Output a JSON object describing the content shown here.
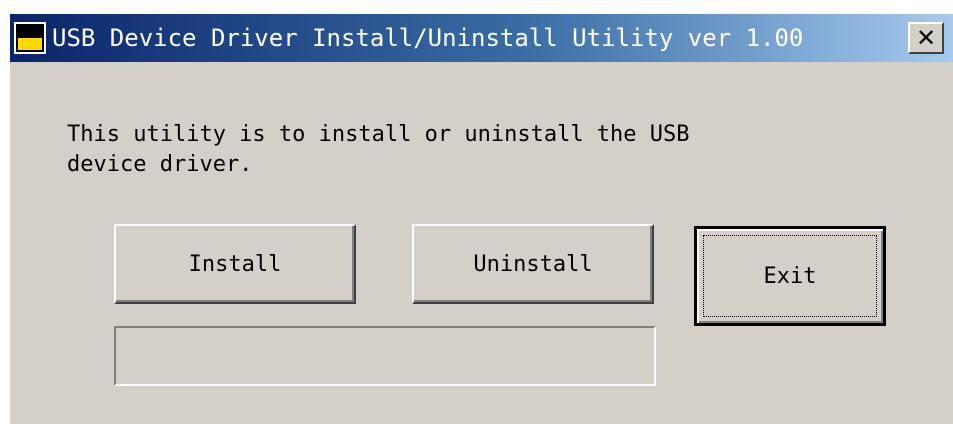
{
  "window": {
    "title": "USB Device Driver Install/Uninstall Utility ver 1.00",
    "close_glyph": "✕",
    "icon": "app-icon"
  },
  "message": {
    "line1": "This utility is to install or uninstall the USB",
    "line2": "device driver."
  },
  "buttons": {
    "install": "Install",
    "uninstall": "Uninstall",
    "exit": "Exit"
  },
  "status": {
    "text": ""
  },
  "colors": {
    "face": "#d4d0c8",
    "title_start": "#0a246a",
    "title_end": "#a6caf0",
    "icon_yellow": "#ffd800"
  }
}
